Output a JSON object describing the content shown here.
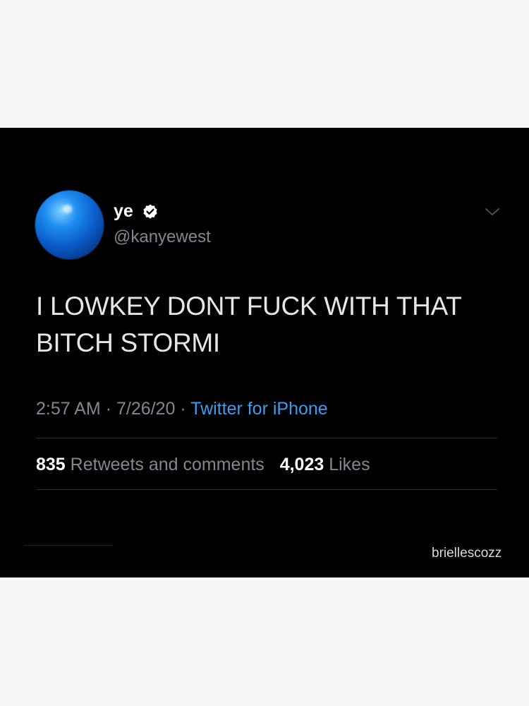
{
  "tweet": {
    "display_name": "ye",
    "handle": "@kanyewest",
    "text": "I LOWKEY DONT FUCK WITH THAT BITCH STORMI",
    "time": "2:57 AM",
    "date": "7/26/20",
    "separator": "·",
    "source": "Twitter for iPhone",
    "retweets_count": "835",
    "retweets_label": "Retweets and comments",
    "likes_count": "4,023",
    "likes_label": "Likes"
  },
  "watermark": "briellescozz",
  "icons": {
    "avatar": "blue-sphere-avatar",
    "verified": "verified-badge-icon",
    "menu": "chevron-down-icon"
  },
  "colors": {
    "background": "#000000",
    "accent": "#3d9bf0",
    "muted_text": "#7f8790",
    "page_background": "#f6f6f6"
  }
}
